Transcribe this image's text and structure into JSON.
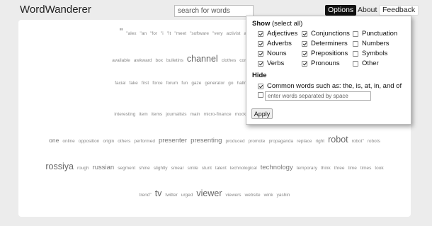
{
  "header": {
    "title": "WordWanderer",
    "search_placeholder": "search for words",
    "options_label": "Options",
    "about_label": "About",
    "feedback_label": "Feedback"
  },
  "cloud_rows": [
    [
      {
        "t": "\"",
        "s": 3
      },
      {
        "t": "\"alex",
        "s": 0
      },
      {
        "t": "\"an",
        "s": 0
      },
      {
        "t": "\"for",
        "s": 0
      },
      {
        "t": "\"i",
        "s": 0
      },
      {
        "t": "\"it",
        "s": 0
      },
      {
        "t": "\"meet",
        "s": 0
      },
      {
        "t": "\"software",
        "s": 0
      },
      {
        "t": "\"very",
        "s": 0
      },
      {
        "t": "activist",
        "s": 0
      },
      {
        "t": "against",
        "s": 0
      },
      {
        "t": "agriculture",
        "s": 0
      },
      {
        "t": "ar",
        "s": 0
      },
      {
        "t": "alcohol",
        "s": 0
      }
    ],
    [
      {
        "t": "available",
        "s": 0
      },
      {
        "t": "awkward",
        "s": 0
      },
      {
        "t": "box",
        "s": 0
      },
      {
        "t": "bulletins",
        "s": 0
      },
      {
        "t": "channel",
        "s": 3
      },
      {
        "t": "clothes",
        "s": 0
      },
      {
        "t": "components",
        "s": 0
      },
      {
        "t": "conference",
        "s": 0
      },
      {
        "t": "country\"",
        "s": 0
      },
      {
        "t": "c",
        "s": 0
      }
    ],
    [
      {
        "t": "facial",
        "s": 0
      },
      {
        "t": "fake",
        "s": 0
      },
      {
        "t": "first",
        "s": 0
      },
      {
        "t": "force",
        "s": 0
      },
      {
        "t": "forum",
        "s": 0
      },
      {
        "t": "fun",
        "s": 0
      },
      {
        "t": "gaze",
        "s": 0
      },
      {
        "t": "generator",
        "s": 0
      },
      {
        "t": "go",
        "s": 0
      },
      {
        "t": "hallmarks",
        "s": 0
      },
      {
        "t": "hero",
        "s": 0
      },
      {
        "t": "holding",
        "s": 0
      },
      {
        "t": "hostage",
        "s": 0
      },
      {
        "t": "ill",
        "s": 0
      }
    ],
    [
      {
        "t": "interesting",
        "s": 0
      },
      {
        "t": "item",
        "s": 0
      },
      {
        "t": "items",
        "s": 0
      },
      {
        "t": "journalists",
        "s": 0
      },
      {
        "t": "main",
        "s": 0
      },
      {
        "t": "micro-finance",
        "s": 0
      },
      {
        "t": "mocked",
        "s": 0
      },
      {
        "t": "moscow",
        "s": 0
      },
      {
        "t": "new",
        "s": 0
      },
      {
        "t": "newest",
        "s": 0
      },
      {
        "t": "ne",
        "s": 3
      }
    ],
    [
      {
        "t": "one",
        "s": 1
      },
      {
        "t": "online",
        "s": 0
      },
      {
        "t": "opposition",
        "s": 0
      },
      {
        "t": "origin",
        "s": 0
      },
      {
        "t": "others",
        "s": 0
      },
      {
        "t": "performed",
        "s": 0
      },
      {
        "t": "presenter",
        "s": 2
      },
      {
        "t": "presenting",
        "s": 2
      },
      {
        "t": "produced",
        "s": 0
      },
      {
        "t": "promote",
        "s": 0
      },
      {
        "t": "propaganda",
        "s": 0
      },
      {
        "t": "replace",
        "s": 0
      },
      {
        "t": "right",
        "s": 0
      },
      {
        "t": "robot",
        "s": 3
      },
      {
        "t": "robot\"",
        "s": 0
      },
      {
        "t": "robots",
        "s": 0
      }
    ],
    [
      {
        "t": "rossiya",
        "s": 3
      },
      {
        "t": "rough",
        "s": 0
      },
      {
        "t": "russian",
        "s": 2
      },
      {
        "t": "segment",
        "s": 0
      },
      {
        "t": "shine",
        "s": 0
      },
      {
        "t": "slightly",
        "s": 0
      },
      {
        "t": "smear",
        "s": 0
      },
      {
        "t": "smile",
        "s": 0
      },
      {
        "t": "stunt",
        "s": 0
      },
      {
        "t": "talent",
        "s": 0
      },
      {
        "t": "technological",
        "s": 0
      },
      {
        "t": "technology",
        "s": 2
      },
      {
        "t": "temporary",
        "s": 0
      },
      {
        "t": "think",
        "s": 0
      },
      {
        "t": "three",
        "s": 0
      },
      {
        "t": "time",
        "s": 0
      },
      {
        "t": "times",
        "s": 0
      },
      {
        "t": "took",
        "s": 0
      }
    ],
    [
      {
        "t": "trend\"",
        "s": 0
      },
      {
        "t": "tv",
        "s": 3
      },
      {
        "t": "twitter",
        "s": 0
      },
      {
        "t": "urged",
        "s": 0
      },
      {
        "t": "viewer",
        "s": 3
      },
      {
        "t": "viewers",
        "s": 0
      },
      {
        "t": "website",
        "s": 0
      },
      {
        "t": "wink",
        "s": 0
      },
      {
        "t": "yashin",
        "s": 0
      }
    ]
  ],
  "options_panel": {
    "show_heading": "Show",
    "show_suffix": "(select all)",
    "pos_options": [
      {
        "label": "Adjectives",
        "checked": true
      },
      {
        "label": "Conjunctions",
        "checked": true
      },
      {
        "label": "Punctuation",
        "checked": false
      },
      {
        "label": "Adverbs",
        "checked": true
      },
      {
        "label": "Determiners",
        "checked": true
      },
      {
        "label": "Numbers",
        "checked": false
      },
      {
        "label": "Nouns",
        "checked": true
      },
      {
        "label": "Prepositions",
        "checked": true
      },
      {
        "label": "Symbols",
        "checked": false
      },
      {
        "label": "Verbs",
        "checked": true
      },
      {
        "label": "Pronouns",
        "checked": true
      },
      {
        "label": "Other",
        "checked": false
      }
    ],
    "hide_heading": "Hide",
    "common_words_label": "Common words such as: the, is, at, in, and of",
    "common_words_checked": true,
    "exclude_checked": false,
    "exclude_placeholder": "enter words separated by space",
    "apply_label": "Apply"
  }
}
